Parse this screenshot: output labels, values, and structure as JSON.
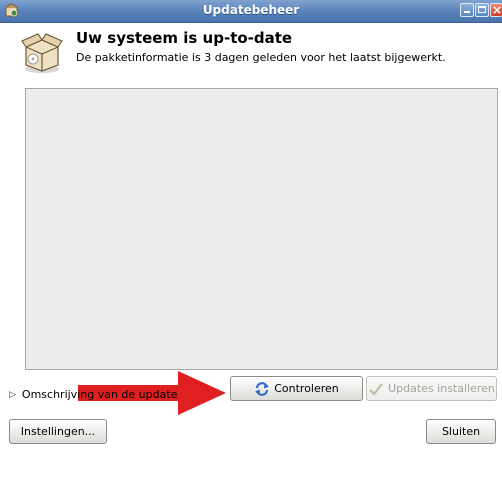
{
  "window": {
    "title": "Updatebeheer",
    "icons": {
      "app": "update-manager-icon",
      "minimize": "minimize-icon",
      "maximize": "maximize-icon",
      "close": "close-icon"
    }
  },
  "header": {
    "icon": "package-box-icon",
    "title": "Uw systeem is up-to-date",
    "subtitle": "De pakketinformatie is 3 dagen geleden voor het laatst bijgewerkt."
  },
  "update_list": {
    "items": []
  },
  "actions": {
    "check_label": "Controleren",
    "check_icon": "refresh-icon",
    "install_label": "Updates installeren",
    "install_icon": "checkmark-icon",
    "install_enabled": false
  },
  "expander": {
    "label": "Omschrijving van de update",
    "expanded": false
  },
  "footer": {
    "settings_label": "Instellingen...",
    "close_label": "Sluiten"
  },
  "colors": {
    "titlebar": "#5781b8",
    "annotation_arrow": "#e02020",
    "list_background": "#eeedeb"
  }
}
